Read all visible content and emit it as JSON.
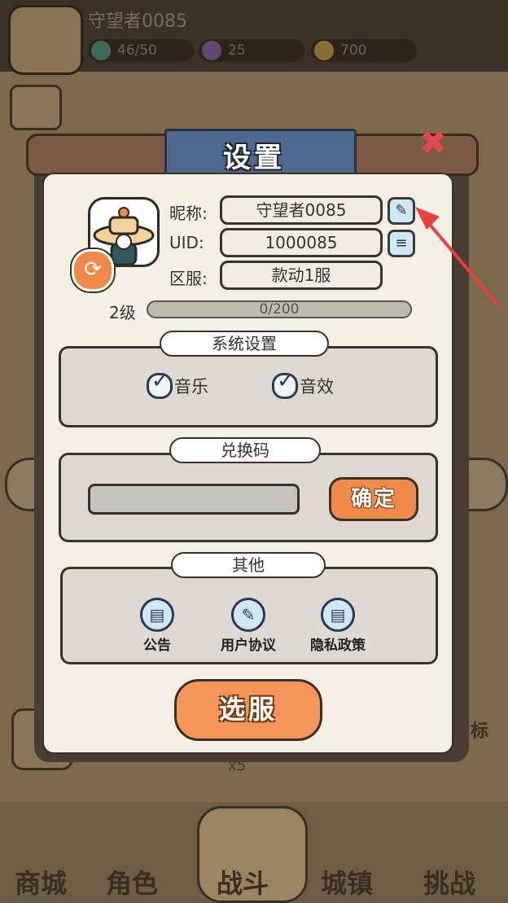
{
  "background": {
    "player_name": "守望者0085",
    "resources": [
      {
        "icon": "gem-icon",
        "value": "46/50"
      },
      {
        "icon": "crystal-icon",
        "value": "25"
      },
      {
        "icon": "coin-icon",
        "value": "700"
      }
    ],
    "side_label": "目标",
    "multiplier": "x5",
    "tabs": [
      "商城",
      "角色",
      "战斗",
      "城镇",
      "挑战"
    ]
  },
  "dialog": {
    "title": "设置",
    "close_icon": "close-icon",
    "profile": {
      "nickname_label": "昵称:",
      "nickname_value": "守望者0085",
      "uid_label": "UID:",
      "uid_value": "1000085",
      "server_label": "区服:",
      "server_value": "款动1服",
      "level_label": "2级",
      "exp_text": "0/200",
      "exp_fraction": 0
    },
    "system_settings": {
      "title": "系统设置",
      "music_label": "音乐",
      "music_checked": true,
      "sfx_label": "音效",
      "sfx_checked": true
    },
    "redeem": {
      "title": "兑换码",
      "input_value": "",
      "confirm_label": "确定"
    },
    "other": {
      "title": "其他",
      "items": [
        {
          "label": "公告",
          "icon": "notice-icon"
        },
        {
          "label": "用户协议",
          "icon": "agreement-icon"
        },
        {
          "label": "隐私政策",
          "icon": "privacy-icon"
        }
      ]
    },
    "select_server_label": "选服"
  },
  "colors": {
    "accent_orange": "#f08a4b",
    "title_blue": "#4f6890",
    "close_red": "#e5484d",
    "annotation_arrow": "#e8413c"
  }
}
